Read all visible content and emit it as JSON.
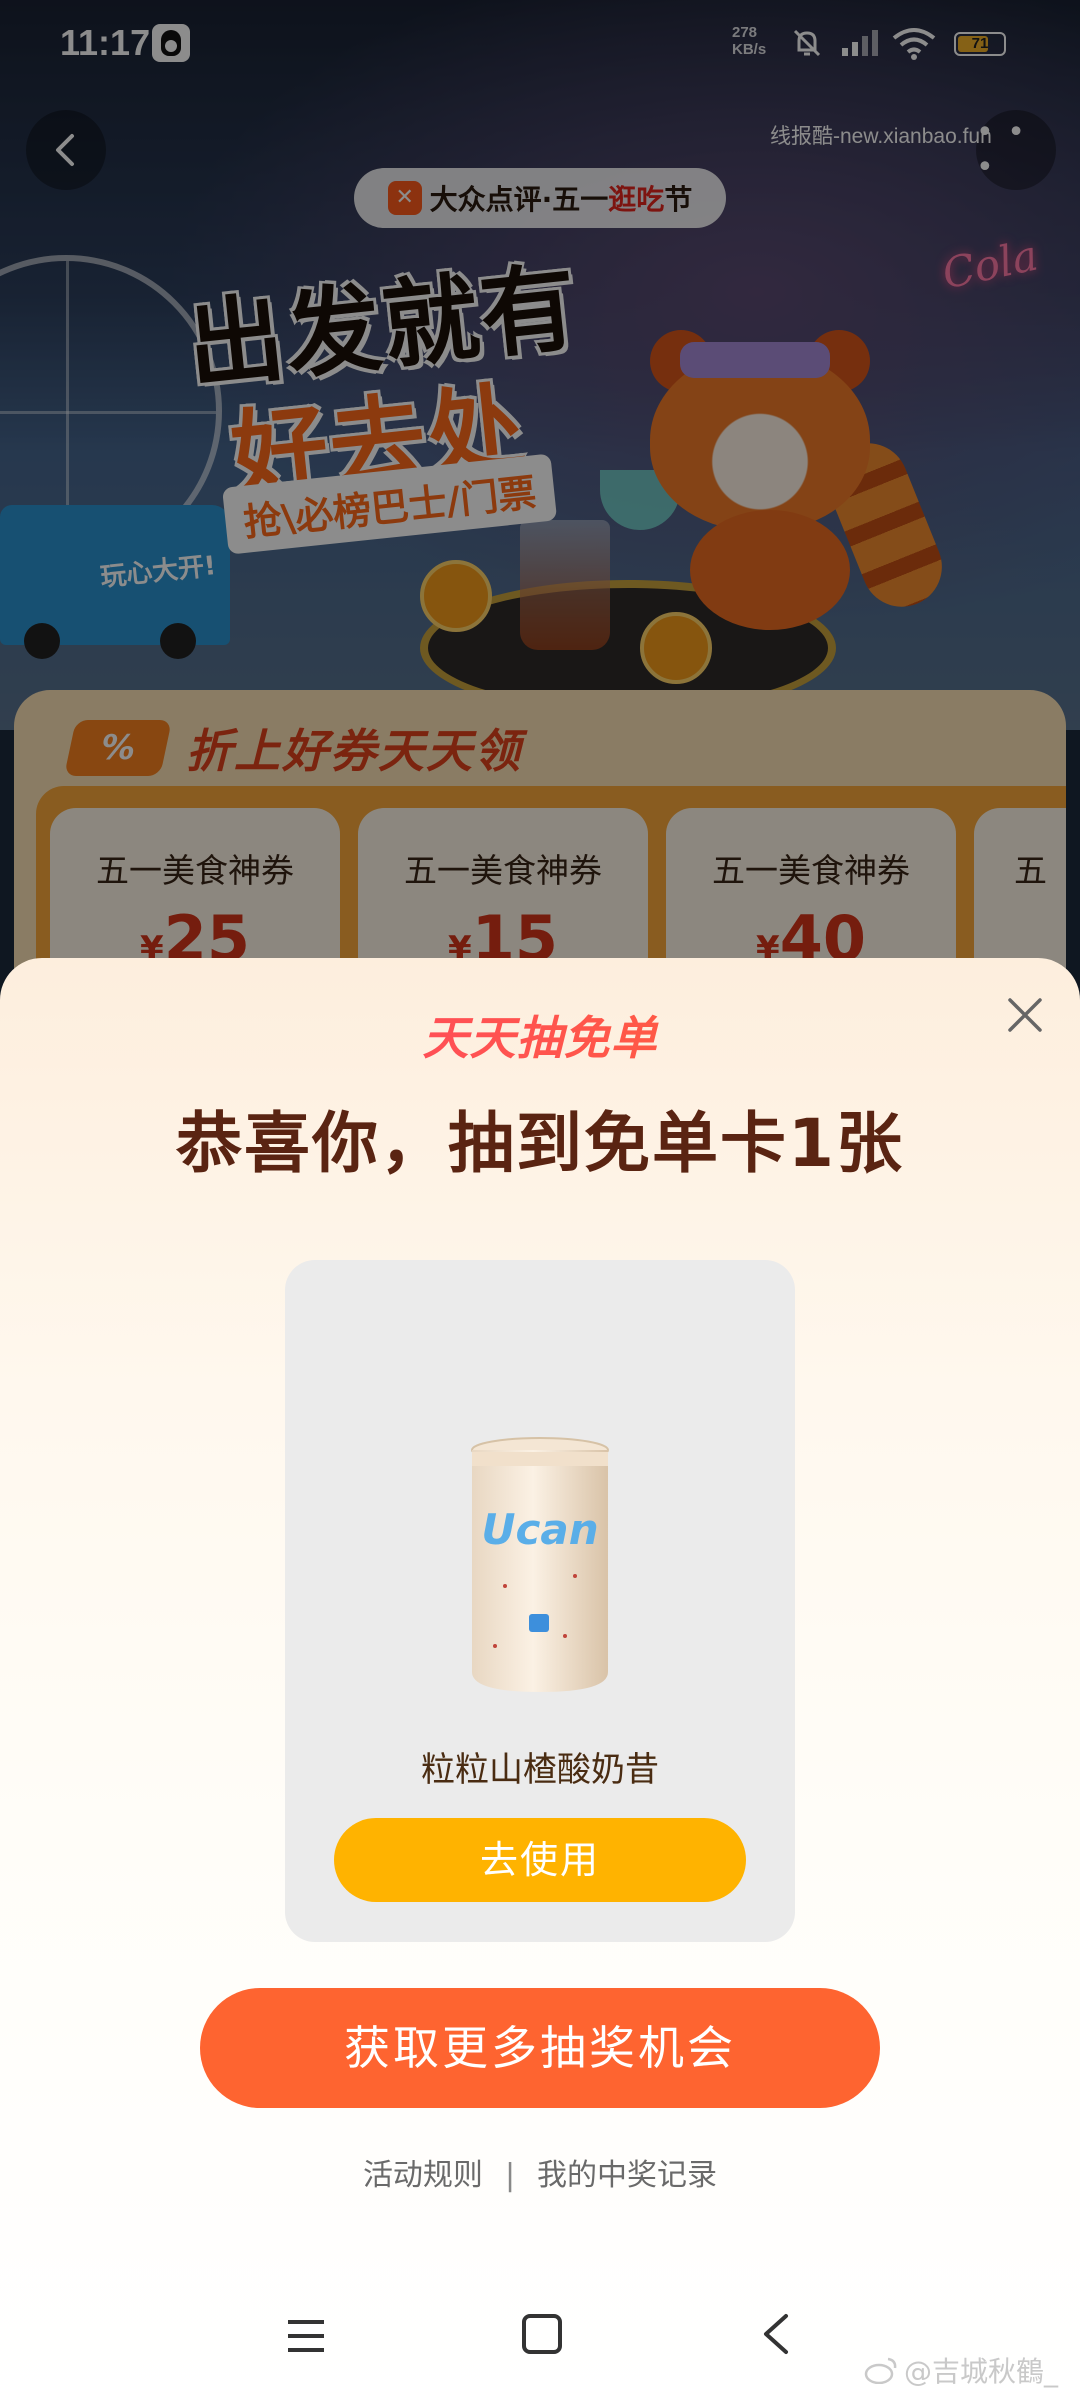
{
  "status_bar": {
    "time": "11:17",
    "net_speed_value": "278",
    "net_speed_unit": "KB/s",
    "battery_level": "71",
    "battery_fraction": 0.71
  },
  "top_nav": {
    "watermark": "线报酷-new.xianbao.fun",
    "more_label": "• • •"
  },
  "hero": {
    "brand": "大众点评·五一",
    "brand_accent": "逛吃",
    "brand_suffix": "节",
    "title_line1": "出发就有",
    "title_line2": "好去处",
    "subtitle": "抢\\必榜巴士/门票",
    "bus_text": "玩心大开!",
    "neon_text": "Cola"
  },
  "coupons": {
    "badge": "%",
    "title": "折上好券天天领",
    "items": [
      {
        "name": "五一美食神券",
        "currency": "¥",
        "amount": "25"
      },
      {
        "name": "五一美食神券",
        "currency": "¥",
        "amount": "15"
      },
      {
        "name": "五一美食神券",
        "currency": "¥",
        "amount": "40"
      },
      {
        "name": "五",
        "currency": "",
        "amount": ""
      }
    ]
  },
  "prize_sheet": {
    "brand": "天天抽免单",
    "title": "恭喜你，抽到免单卡1张",
    "product_brand": "Ucan",
    "product_name": "粒粒山楂酸奶昔",
    "use_button": "去使用",
    "more_chances_button": "获取更多抽奖机会",
    "rules_link": "活动规则",
    "separator": "|",
    "records_link": "我的中奖记录"
  },
  "watermark_bottom": "@吉城秋鶴_",
  "colors": {
    "accent_orange": "#fe6430",
    "use_button_yellow": "#ffb300",
    "title_brown": "#5a2412",
    "coupon_red": "#d6361a"
  }
}
